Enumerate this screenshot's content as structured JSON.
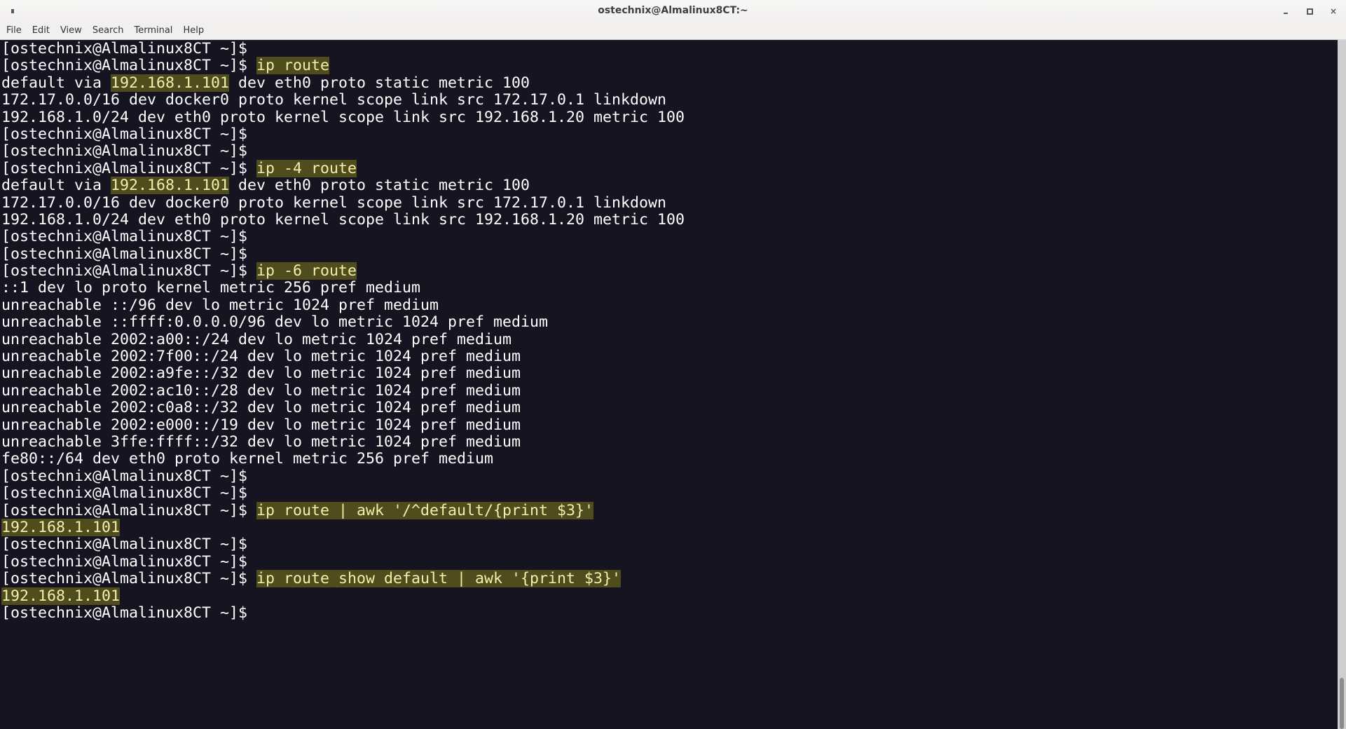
{
  "window": {
    "title": "ostechnix@Almalinux8CT:~",
    "icon": "terminal-icon",
    "controls": {
      "minimize": "minimize",
      "maximize": "maximize",
      "close": "×"
    }
  },
  "menu": [
    "File",
    "Edit",
    "View",
    "Search",
    "Terminal",
    "Help"
  ],
  "colors": {
    "terminal_bg": "#171421",
    "text": "#ffffff",
    "highlight_bg": "#4f4c1e",
    "highlight_text": "#f3efaa"
  },
  "prompt": "[ostechnix@Almalinux8CT ~]$",
  "lines": [
    {
      "prompt": true,
      "cmd": ""
    },
    {
      "prompt": true,
      "cmd": "ip route"
    },
    {
      "segments": [
        {
          "t": "default via "
        },
        {
          "t": "192.168.1.101",
          "hl": true
        },
        {
          "t": " dev eth0 proto static metric 100"
        }
      ]
    },
    {
      "segments": [
        {
          "t": "172.17.0.0/16 dev docker0 proto kernel scope link src 172.17.0.1 linkdown"
        }
      ]
    },
    {
      "segments": [
        {
          "t": "192.168.1.0/24 dev eth0 proto kernel scope link src 192.168.1.20 metric 100"
        }
      ]
    },
    {
      "prompt": true,
      "cmd": ""
    },
    {
      "prompt": true,
      "cmd": ""
    },
    {
      "prompt": true,
      "cmd": "ip -4 route"
    },
    {
      "segments": [
        {
          "t": "default via "
        },
        {
          "t": "192.168.1.101",
          "hl": true
        },
        {
          "t": " dev eth0 proto static metric 100"
        }
      ]
    },
    {
      "segments": [
        {
          "t": "172.17.0.0/16 dev docker0 proto kernel scope link src 172.17.0.1 linkdown"
        }
      ]
    },
    {
      "segments": [
        {
          "t": "192.168.1.0/24 dev eth0 proto kernel scope link src 192.168.1.20 metric 100"
        }
      ]
    },
    {
      "prompt": true,
      "cmd": ""
    },
    {
      "prompt": true,
      "cmd": ""
    },
    {
      "prompt": true,
      "cmd": "ip -6 route"
    },
    {
      "segments": [
        {
          "t": "::1 dev lo proto kernel metric 256 pref medium"
        }
      ]
    },
    {
      "segments": [
        {
          "t": "unreachable ::/96 dev lo metric 1024 pref medium"
        }
      ]
    },
    {
      "segments": [
        {
          "t": "unreachable ::ffff:0.0.0.0/96 dev lo metric 1024 pref medium"
        }
      ]
    },
    {
      "segments": [
        {
          "t": "unreachable 2002:a00::/24 dev lo metric 1024 pref medium"
        }
      ]
    },
    {
      "segments": [
        {
          "t": "unreachable 2002:7f00::/24 dev lo metric 1024 pref medium"
        }
      ]
    },
    {
      "segments": [
        {
          "t": "unreachable 2002:a9fe::/32 dev lo metric 1024 pref medium"
        }
      ]
    },
    {
      "segments": [
        {
          "t": "unreachable 2002:ac10::/28 dev lo metric 1024 pref medium"
        }
      ]
    },
    {
      "segments": [
        {
          "t": "unreachable 2002:c0a8::/32 dev lo metric 1024 pref medium"
        }
      ]
    },
    {
      "segments": [
        {
          "t": "unreachable 2002:e000::/19 dev lo metric 1024 pref medium"
        }
      ]
    },
    {
      "segments": [
        {
          "t": "unreachable 3ffe:ffff::/32 dev lo metric 1024 pref medium"
        }
      ]
    },
    {
      "segments": [
        {
          "t": "fe80::/64 dev eth0 proto kernel metric 256 pref medium"
        }
      ]
    },
    {
      "prompt": true,
      "cmd": ""
    },
    {
      "prompt": true,
      "cmd": ""
    },
    {
      "prompt": true,
      "cmd": "ip route | awk '/^default/{print $3}'"
    },
    {
      "segments": [
        {
          "t": "192.168.1.101",
          "hl": true
        }
      ]
    },
    {
      "prompt": true,
      "cmd": ""
    },
    {
      "prompt": true,
      "cmd": ""
    },
    {
      "prompt": true,
      "cmd": "ip route show default | awk '{print $3}'"
    },
    {
      "segments": [
        {
          "t": "192.168.1.101",
          "hl": true
        }
      ]
    },
    {
      "prompt": true,
      "cmd": ""
    }
  ],
  "scrollbar": {
    "position": "bottom"
  }
}
